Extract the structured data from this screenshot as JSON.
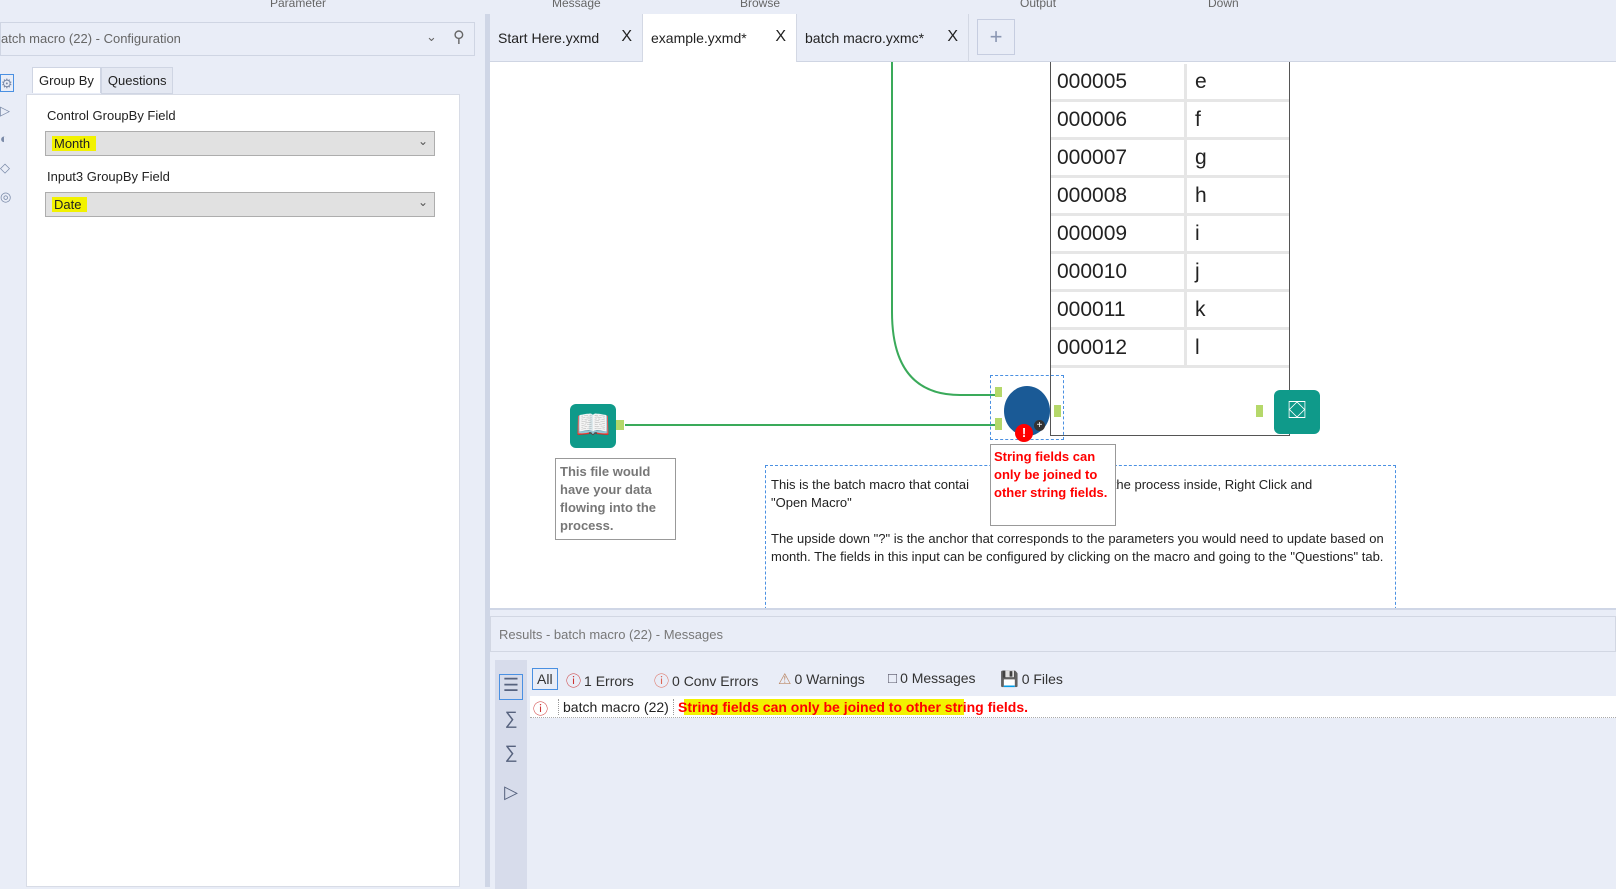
{
  "top_labels": [
    "Parameter",
    "Message",
    "Browse",
    "Output",
    "Down"
  ],
  "config": {
    "title": "atch macro (22) - Configuration",
    "tabs": [
      {
        "label": "Group By",
        "active": true
      },
      {
        "label": "Questions",
        "active": false
      }
    ],
    "fields": [
      {
        "label": "Control GroupBy Field",
        "value": "Month"
      },
      {
        "label": "Input3 GroupBy Field",
        "value": "Date"
      }
    ],
    "side_icons": [
      "gear-icon",
      "tag-icon",
      "circle-icon",
      "diamond-icon",
      "target-icon"
    ]
  },
  "doc_tabs": [
    {
      "label": "Start Here.yxmd",
      "active": false
    },
    {
      "label": "example.yxmd*",
      "active": true
    },
    {
      "label": "batch macro.yxmc*",
      "active": false
    }
  ],
  "new_tab": "+",
  "close_glyph": "X",
  "canvas": {
    "table_rows": [
      [
        "000005",
        "e"
      ],
      [
        "000006",
        "f"
      ],
      [
        "000007",
        "g"
      ],
      [
        "000008",
        "h"
      ],
      [
        "000009",
        "i"
      ],
      [
        "000010",
        "j"
      ],
      [
        "000011",
        "k"
      ],
      [
        "000012",
        "l"
      ]
    ],
    "input_note": "This file would have your data flowing into the process.",
    "comment_1": "This is the batch macro that contai",
    "comment_1b": "ok at the process inside, Right Click and",
    "comment_2": "\"Open Macro\"",
    "comment_3": "The upside down \"?\" is the anchor that corresponds to the parameters you would need to update based on month. The fields in this input can be configured by clicking on the macro and going to the \"Questions\" tab.",
    "error_tooltip": "String fields can only be joined to other string fields.",
    "colors": {
      "tool_teal": "#0f9a8a",
      "macro_blue": "#1a5a96",
      "connection_green": "#3aaa5a",
      "connection_blue": "#3344dd",
      "error_red": "#ff0000"
    }
  },
  "results": {
    "title": "Results - batch macro (22) - Messages",
    "filters": [
      {
        "label": "All",
        "icon": ""
      },
      {
        "label": "1 Errors",
        "icon": "error-icon"
      },
      {
        "label": "0 Conv Errors",
        "icon": "conv-error-icon"
      },
      {
        "label": "0 Warnings",
        "icon": "warning-icon"
      },
      {
        "label": "0 Messages",
        "icon": "message-icon"
      },
      {
        "label": "0 Files",
        "icon": "file-icon"
      }
    ],
    "messages": [
      {
        "tool": "batch macro (22)",
        "text": "String fields can only be joined to other string fields."
      }
    ]
  }
}
